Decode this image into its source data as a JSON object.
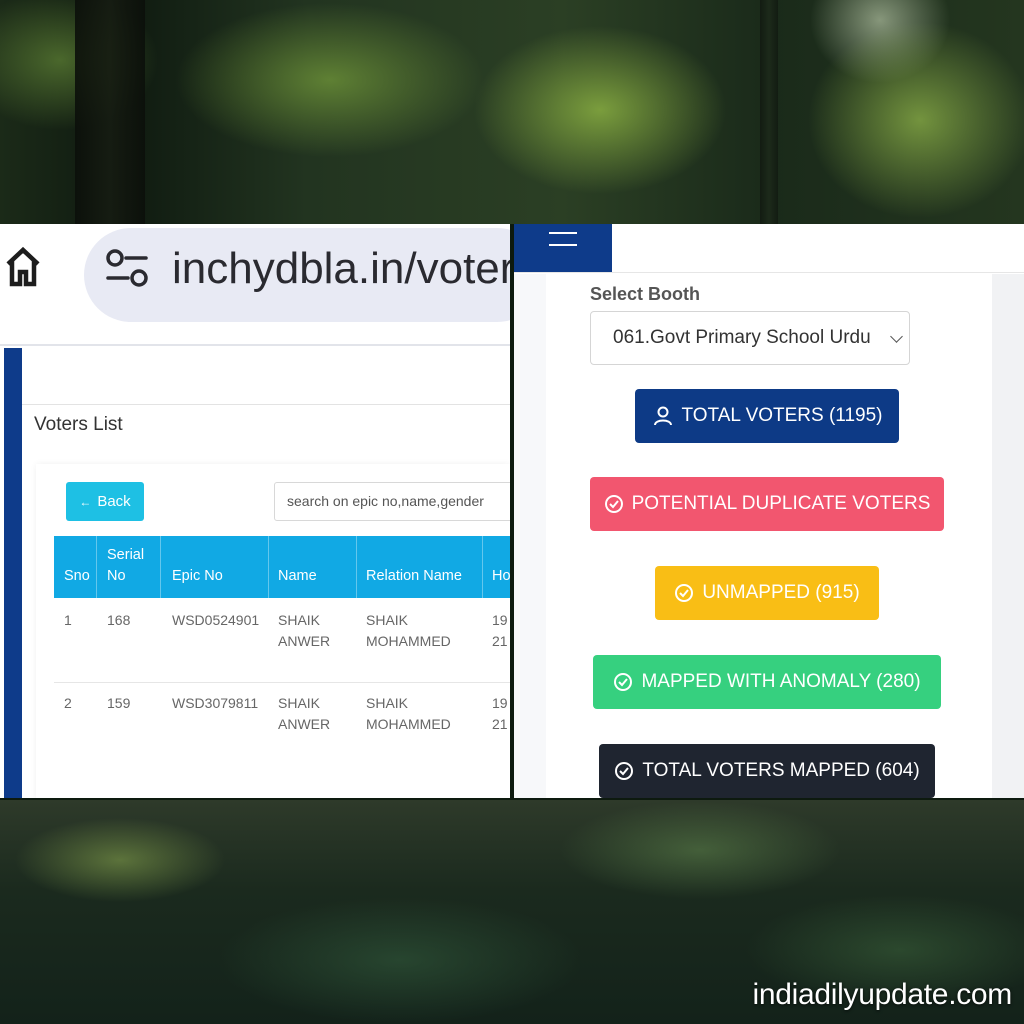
{
  "browser": {
    "url": "inchydbla.in/voter"
  },
  "voters_page": {
    "title": "Voters List",
    "back_label": "Back",
    "search_placeholder": "search on epic no,name,gender",
    "columns": [
      "Sno",
      "Serial No",
      "Epic No",
      "Name",
      "Relation Name",
      "Ho"
    ],
    "rows": [
      {
        "sno": "1",
        "serial": "168",
        "epic": "WSD0524901",
        "name_line1": "SHAIK",
        "name_line2": "ANWER",
        "relation_line1": "SHAIK",
        "relation_line2": "MOHAMMED",
        "ho_line1": "19",
        "ho_line2": "21"
      },
      {
        "sno": "2",
        "serial": "159",
        "epic": "WSD3079811",
        "name_line1": "SHAIK",
        "name_line2": "ANWER",
        "relation_line1": "SHAIK",
        "relation_line2": "MOHAMMED",
        "ho_line1": "19",
        "ho_line2": "21"
      }
    ]
  },
  "booth_panel": {
    "select_label": "Select Booth",
    "selected_booth": "061.Govt Primary School Urdu",
    "buttons": {
      "total_voters": "TOTAL VOTERS (1195)",
      "potential_duplicates": "POTENTIAL DUPLICATE VOTERS",
      "unmapped": "UNMAPPED (915)",
      "mapped_anomaly": "MAPPED WITH ANOMALY (280)",
      "total_mapped": "TOTAL VOTERS MAPPED (604)"
    }
  },
  "watermark": "indiadilyupdate.com",
  "colors": {
    "brand_navy": "#0e3b8a",
    "table_header": "#11a9e4",
    "back_button": "#1ec0e4",
    "total_voters": "#0d3a86",
    "potential_duplicates": "#f2566f",
    "unmapped": "#f9be15",
    "mapped_anomaly": "#36d07f",
    "total_mapped": "#1f2530"
  },
  "icons": {
    "home": "home-icon",
    "site_settings": "tune-icon",
    "menu": "hamburger-icon",
    "back_arrow": "arrow-left-icon",
    "user": "user-icon",
    "check_circle": "check-circle-icon"
  }
}
